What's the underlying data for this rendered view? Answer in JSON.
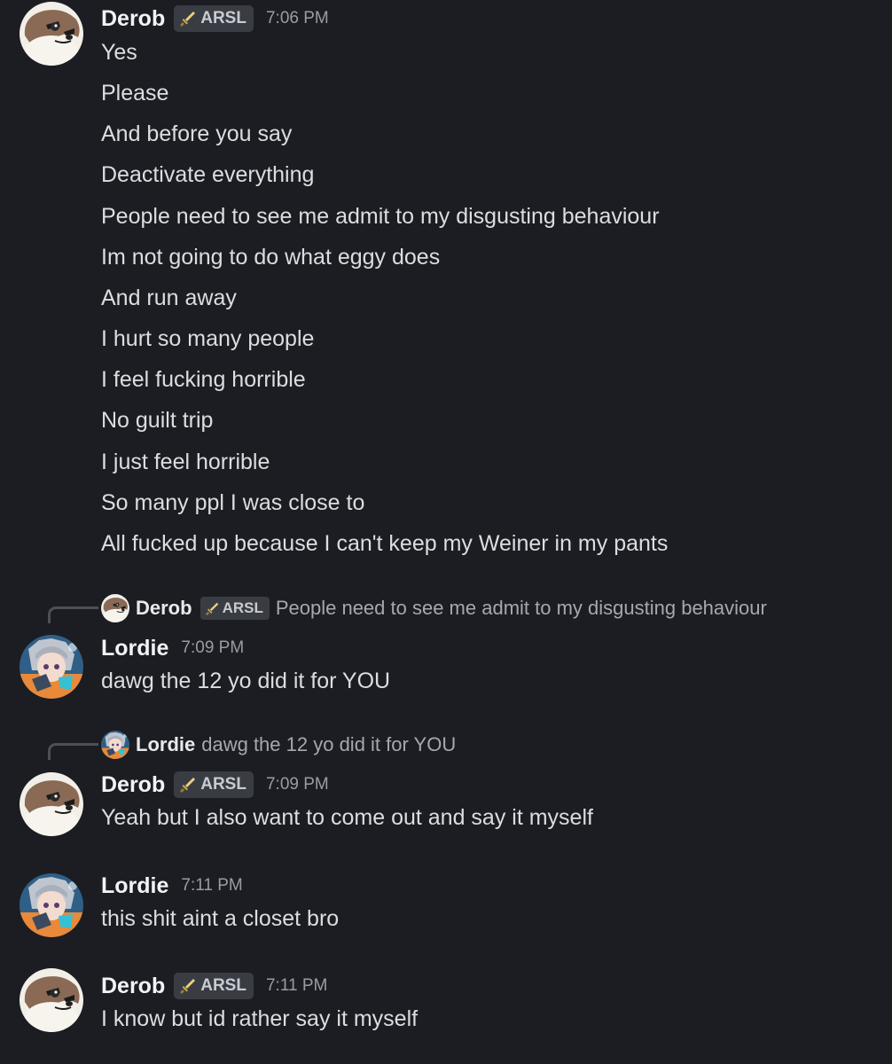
{
  "messages": [
    {
      "author": "Derob",
      "tag": "ARSL",
      "time": "7:06 PM",
      "lines": [
        "Yes",
        "Please",
        "And before you say",
        "Deactivate everything",
        "People need to see me admit to my disgusting behaviour",
        "Im not going to do what eggy does",
        "And run away",
        "I hurt so many people",
        "I feel fucking horrible",
        "No guilt trip",
        "I just feel horrible",
        "So many ppl I was close to",
        "All fucked up because I can't keep my Weiner in my pants"
      ]
    },
    {
      "reply": {
        "author": "Derob",
        "tag": "ARSL",
        "text": "People need to see me admit to my disgusting behaviour"
      },
      "author": "Lordie",
      "time": "7:09 PM",
      "lines": [
        "dawg the 12 yo did it for YOU"
      ]
    },
    {
      "reply": {
        "author": "Lordie",
        "text": "dawg the 12 yo did it for YOU"
      },
      "author": "Derob",
      "tag": "ARSL",
      "time": "7:09 PM",
      "lines": [
        "Yeah but I also want to come out and say it myself"
      ]
    },
    {
      "author": "Lordie",
      "time": "7:11 PM",
      "lines": [
        "this shit aint a closet bro"
      ]
    },
    {
      "author": "Derob",
      "tag": "ARSL",
      "time": "7:11 PM",
      "lines": [
        "I know but id rather say it myself"
      ]
    }
  ],
  "icons": {
    "tag_icon": "sword-icon",
    "derob_avatar": "otter-avatar",
    "lordie_avatar": "anime-avatar"
  },
  "colors": {
    "background": "#1c1d22",
    "text": "#dcdde1",
    "muted": "#9a9ca4",
    "tag_bg": "#3a3c43"
  }
}
